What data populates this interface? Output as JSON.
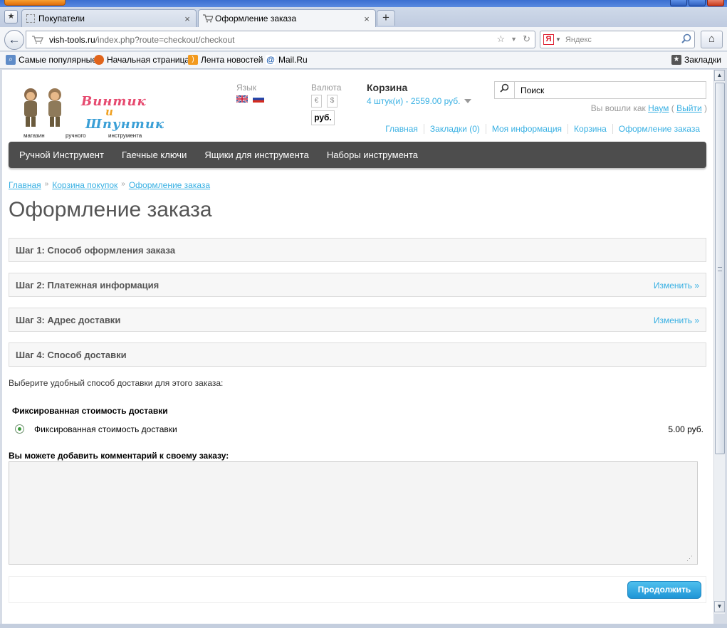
{
  "browser": {
    "tabs": [
      {
        "title": "Покупатели",
        "active": false
      },
      {
        "title": "Оформление заказа",
        "active": true
      }
    ],
    "url_host": "vish-tools.ru",
    "url_path": "/index.php?route=checkout/checkout",
    "search_engine_placeholder": "Яндекс",
    "bookmarks": [
      "Самые популярные",
      "Начальная страница",
      "Лента новостей",
      "Mail.Ru"
    ],
    "bookmarks_menu": "Закладки"
  },
  "header": {
    "logo": {
      "word1": "Винтик",
      "word2": "и",
      "word3": "Шпунтик",
      "subtitle": [
        "магазин",
        "ручного",
        "инструмента"
      ]
    },
    "language_label": "Язык",
    "currency_label": "Валюта",
    "currency_symbols": [
      "€",
      "$"
    ],
    "currency_active": "руб.",
    "cart_title": "Корзина",
    "cart_summary": "4 штук(и) - 2559.00 руб.",
    "search_placeholder": "Поиск",
    "welcome_prefix": "Вы вошли как",
    "welcome_user": "Наум",
    "welcome_logout": "Выйти",
    "top_links": [
      "Главная",
      "Закладки (0)",
      "Моя информация",
      "Корзина",
      "Оформление заказа"
    ]
  },
  "menu": [
    "Ручной Инструмент",
    "Гаечные ключи",
    "Ящики для инструмента",
    "Наборы инструмента"
  ],
  "breadcrumb": [
    "Главная",
    "Корзина покупок",
    "Оформление заказа"
  ],
  "page_title": "Оформление заказа",
  "steps": [
    {
      "title": "Шаг 1: Способ оформления заказа",
      "edit": ""
    },
    {
      "title": "Шаг 2: Платежная информация",
      "edit": "Изменить »"
    },
    {
      "title": "Шаг 3: Адрес доставки",
      "edit": "Изменить »"
    },
    {
      "title": "Шаг 4: Способ доставки",
      "edit": ""
    }
  ],
  "shipping": {
    "intro": "Выберите удобный способ доставки для этого заказа:",
    "method_heading": "Фиксированная стоимость доставки",
    "option_label": "Фиксированная стоимость доставки",
    "option_price": "5.00 руб.",
    "selected": true
  },
  "comment_label": "Вы можете добавить комментарий к своему заказу:",
  "comment_value": "",
  "continue_button": "Продолжить"
}
